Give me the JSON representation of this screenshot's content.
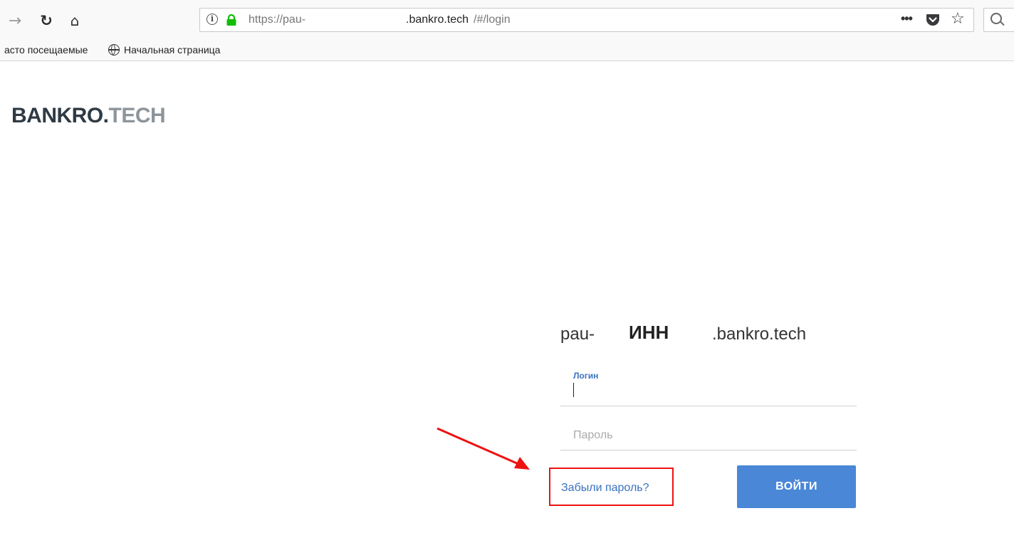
{
  "browser": {
    "nav": {
      "forward_glyph": "→",
      "reload_glyph": "↻",
      "home_glyph": "⌂"
    },
    "url": {
      "scheme": "https://pau-",
      "host": ".bankro.tech",
      "path": "/#/login"
    },
    "page_actions": {
      "more_glyph": "•••",
      "star_glyph": "☆"
    },
    "bookmarks": {
      "most_visited": "асто посещаемые",
      "home_page": "Начальная страница"
    }
  },
  "page": {
    "logo": {
      "part1": "BANKRO.",
      "part2": "TECH"
    },
    "host_line": {
      "prefix": "pau-",
      "inn": "ИНН",
      "suffix": ".bankro.tech"
    },
    "login_field": {
      "label": "Логин",
      "value": ""
    },
    "password_field": {
      "placeholder": "Пароль"
    },
    "forgot_password": "Забыли пароль?",
    "login_button": "ВОЙТИ"
  },
  "colors": {
    "accent": "#4a87d6",
    "link": "#3a72c0",
    "highlight": "#ee1111",
    "lock": "#12bc00"
  }
}
